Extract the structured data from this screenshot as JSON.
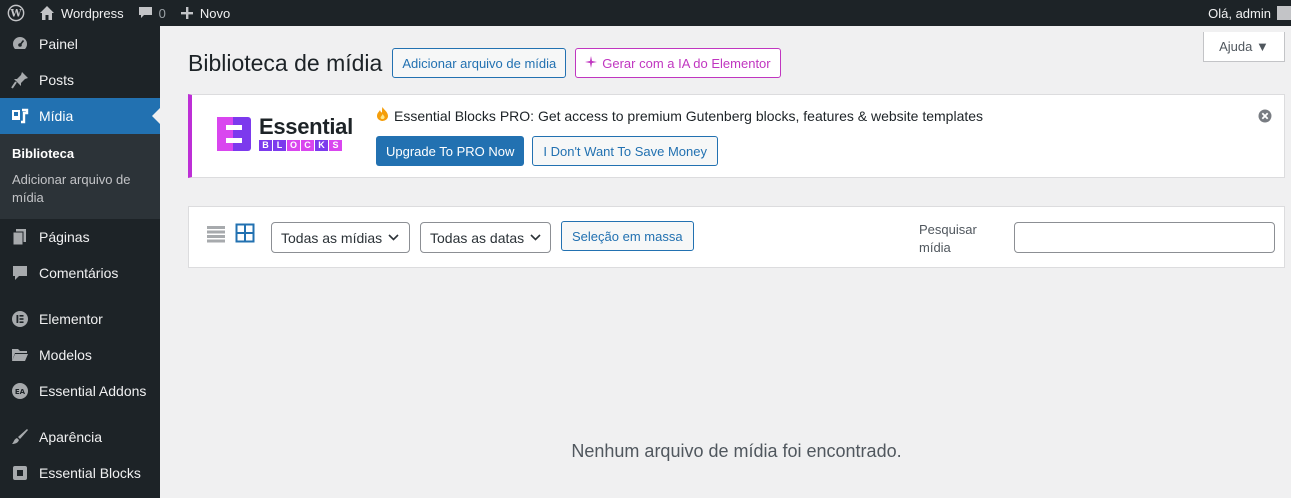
{
  "adminbar": {
    "site_name": "Wordpress",
    "comments_count": "0",
    "new_label": "Novo",
    "greeting": "Olá, admin"
  },
  "sidebar": {
    "items": [
      {
        "label": "Painel",
        "icon": "dashboard-icon"
      },
      {
        "label": "Posts",
        "icon": "pin-icon"
      },
      {
        "label": "Mídia",
        "icon": "media-icon",
        "current": true
      },
      {
        "label": "Páginas",
        "icon": "pages-icon"
      },
      {
        "label": "Comentários",
        "icon": "comments-icon"
      },
      {
        "label": "Elementor",
        "icon": "elementor-icon"
      },
      {
        "label": "Modelos",
        "icon": "folder-icon"
      },
      {
        "label": "Essential Addons",
        "icon": "essential-addons-icon"
      },
      {
        "label": "Aparência",
        "icon": "brush-icon"
      },
      {
        "label": "Essential Blocks",
        "icon": "essential-blocks-icon"
      }
    ],
    "submenu": [
      "Biblioteca",
      "Adicionar arquivo de mídia"
    ]
  },
  "header": {
    "title": "Biblioteca de mídia",
    "add_button": "Adicionar arquivo de mídia",
    "ai_button": "Gerar com a IA do Elementor",
    "help_label": "Ajuda ▼"
  },
  "notice": {
    "logo_word": "Essential",
    "logo_sub": [
      "B",
      "L",
      "O",
      "C",
      "K",
      "S"
    ],
    "message": "Essential Blocks PRO: Get access to premium Gutenberg blocks, features & website templates",
    "primary_button": "Upgrade To PRO Now",
    "secondary_button": "I Don't Want To Save Money",
    "accent": "#bd2fd6"
  },
  "toolbar": {
    "media_filter": "Todas as mídias",
    "date_filter": "Todas as datas",
    "bulk_button": "Seleção em massa",
    "search_label": "Pesquisar mídia",
    "search_value": ""
  },
  "empty_message": "Nenhum arquivo de mídia foi encontrado.",
  "colors": {
    "primary": "#2271b1",
    "sidebar_bg": "#1d2327",
    "ai_accent": "#c036c0"
  }
}
